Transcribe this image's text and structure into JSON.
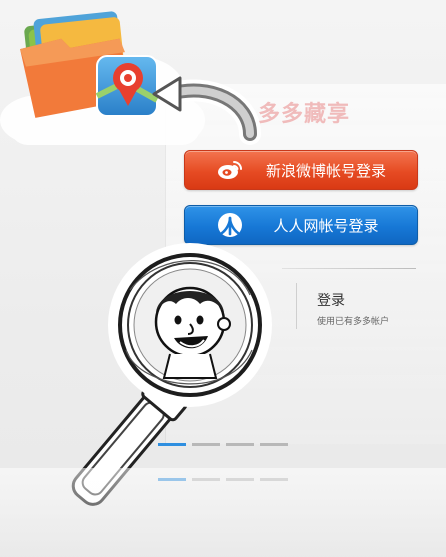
{
  "brand": {
    "text": "多多藏享"
  },
  "buttons": {
    "weibo_label": "新浪微博帐号登录",
    "renren_label": "人人网帐号登录"
  },
  "login": {
    "title": "登录",
    "subtitle": "使用已有多多帐户"
  },
  "pager": {
    "count": 4,
    "active_index": 0
  },
  "colors": {
    "weibo": "#e64b23",
    "renren": "#1778d6",
    "pager_active": "#2f8fe0",
    "pager_inactive": "#b8b8b8"
  },
  "icons": [
    "folder-stack-icon",
    "map-pin-icon",
    "cloud-icon",
    "curved-arrow-icon",
    "weibo-icon",
    "renren-icon",
    "magnifier-icon",
    "avatar-face-icon"
  ]
}
